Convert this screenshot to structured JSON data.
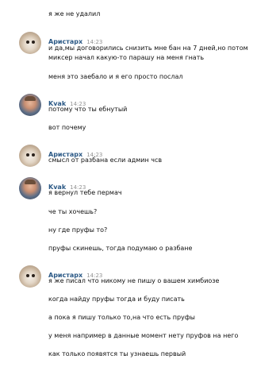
{
  "messages": [
    {
      "lines": [
        "я же не удалил"
      ]
    },
    {
      "author": "Аристарх",
      "time": "14:23",
      "avatar": "dog",
      "lines": [
        "и да,мы договорились снизить мне бан на 7 дней,но потом",
        "миксер начал какую-то парашу на меня гнать",
        "меня это заебало и я его просто послал"
      ]
    },
    {
      "author": "Kvak",
      "time": "14:23",
      "avatar": "man",
      "lines": [
        "потому что ты ебнутый",
        "вот почему"
      ]
    },
    {
      "author": "Аристарх",
      "time": "14:23",
      "avatar": "dog",
      "lines": [
        "смысл от разбана если админ чсв"
      ]
    },
    {
      "author": "Kvak",
      "time": "14:23",
      "avatar": "man",
      "lines": [
        "я вернул тебе пермач",
        "че ты хочешь?",
        "ну где пруфы то?",
        "пруфы скинешь, тогда подумаю о разбане"
      ]
    },
    {
      "author": "Аристарх",
      "time": "14:23",
      "avatar": "dog",
      "lines": [
        "я же писал что никому не пишу о вашем химбиозе",
        "когда найду пруфы тогда и буду писать",
        "а пока я пишу только то,на что есть пруфы",
        "у меня например в данные момент нету пруфов на него",
        "как только появятся ты узнаешь первый"
      ]
    }
  ]
}
